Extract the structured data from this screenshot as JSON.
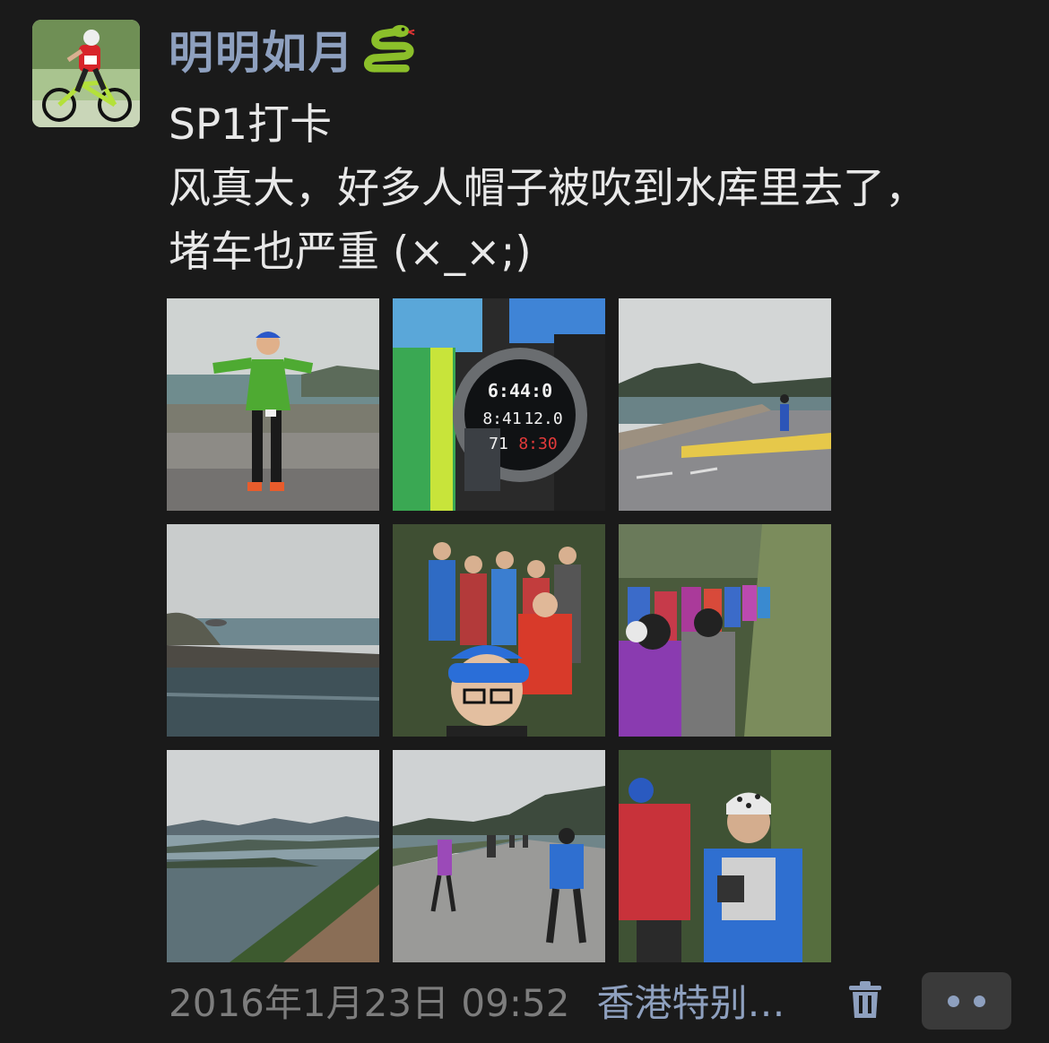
{
  "post": {
    "author": "明明如月",
    "author_emoji": "snake-emoji",
    "text_lines": [
      "SP1打卡",
      "风真大，好多人帽子被吹到水库里去了，",
      "堵车也严重 (×_×;)"
    ],
    "photos": [
      {
        "subject": "runner-thumbs-up-on-dam"
      },
      {
        "subject": "sports-watch-closeup"
      },
      {
        "subject": "runners-on-dam-road"
      },
      {
        "subject": "reservoir-seascape"
      },
      {
        "subject": "selfie-in-crowd"
      },
      {
        "subject": "runners-queue-on-trail"
      },
      {
        "subject": "coastal-hills-view"
      },
      {
        "subject": "runners-on-road"
      },
      {
        "subject": "runner-with-headband-on-trail"
      }
    ],
    "watch_readout": {
      "line1": "6:44:0",
      "line2a": "8:41",
      "line2b": "12.0",
      "line3a": "71",
      "line3b": "8:30"
    },
    "timestamp": "2016年1月23日 09:52",
    "location": "香港特别…"
  },
  "icons": {
    "delete": "trash-icon",
    "more": "more-dots-icon"
  },
  "colors": {
    "background": "#1a1a1a",
    "name_link": "#8ea0bf",
    "body_text": "#e8e8e8",
    "timestamp": "#7d7d7d",
    "more_button_bg": "#3a3a3a"
  }
}
